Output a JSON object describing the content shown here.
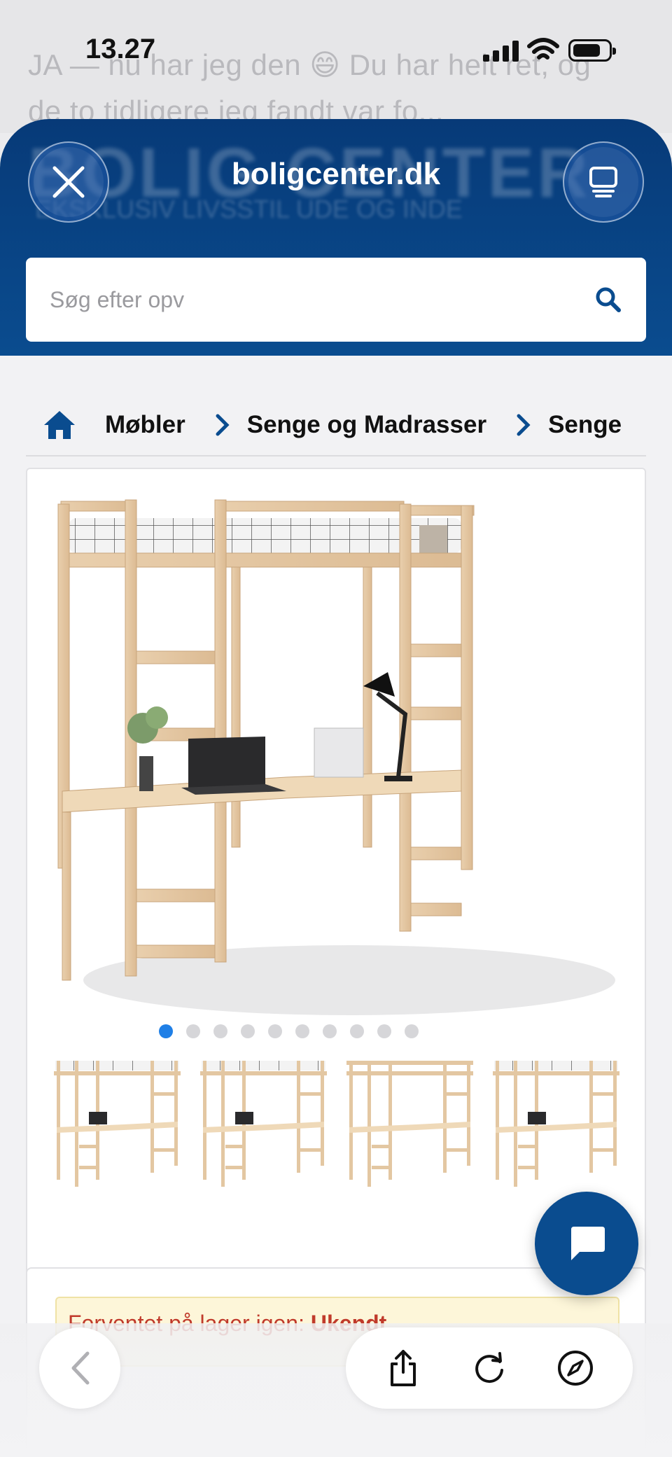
{
  "status_bar": {
    "time": "13.27"
  },
  "background_chat": {
    "line1": "JA — nu har jeg den 😄 Du har helt ret, og",
    "line2": "de to tidligere jeg fandt var fo..."
  },
  "header": {
    "site": "boligcenter.dk",
    "logo_text": "BOLIG CENTER",
    "logo_tagline": "EKSKLUSIV LIVSSTIL UDE OG INDE",
    "brand_color": "#0a4c8f"
  },
  "search": {
    "placeholder": "Søg efter opv"
  },
  "breadcrumb": {
    "items": [
      "Møbler",
      "Senge og Madrasser",
      "Senge"
    ]
  },
  "gallery": {
    "dot_count": 10,
    "active_dot": 0,
    "thumbnail_count": 4
  },
  "stock": {
    "label": "Forventet på lager igen: ",
    "value": "Ukendt"
  },
  "icons": {
    "close": "close-icon",
    "tabs": "tabs-icon",
    "search": "search-icon",
    "home": "home-icon",
    "chat": "chat-icon",
    "back": "chevron-left-icon",
    "share": "share-icon",
    "reload": "reload-icon",
    "compass": "compass-icon"
  }
}
